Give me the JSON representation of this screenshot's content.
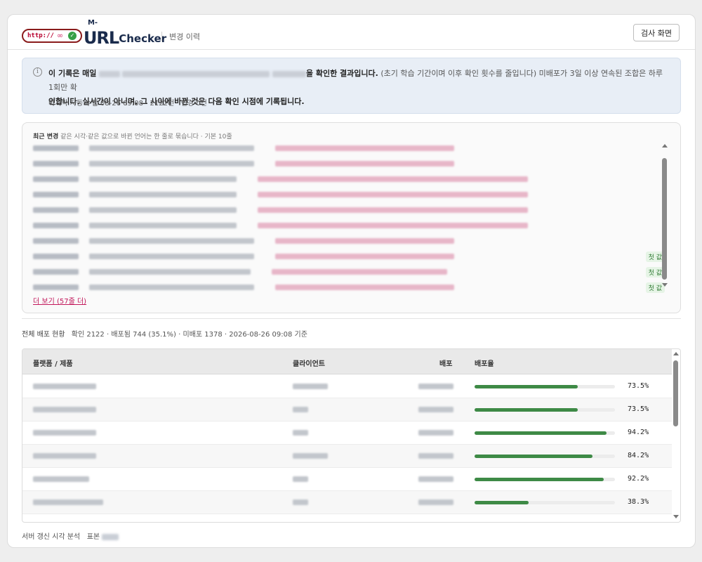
{
  "header": {
    "logo_http": "http://",
    "logo_m": "M-",
    "logo_url": "URL",
    "logo_checker": "Checker",
    "subtitle": "변경 이력",
    "inspect_button": "검사 화면"
  },
  "notice": {
    "line1_a": "이 기록은 매일",
    "line1_b": "을 확인한 결과입니다.",
    "line1_c": "(초기 학습 기간이며 이후 확인 횟수를 줄입니다)",
    "line1_d": "미배포가 3일 이상 연속된 조합은 하루 1회만 확",
    "line2": "인합니다. 실시간이 아니며, 그 사이에 바뀐 것은 다음 확인 시점에 기록됩니다.",
    "meta": "마지막 자동 수집 08-26 09:08 · 2122건 · 변경 0건"
  },
  "changes": {
    "title_bold": "최근 변경",
    "title_rest": "같은 시각·같은 값으로 바뀐 언어는 한 줄로 묶습니다 · 기본 10줄",
    "rows": [
      {
        "badge": ""
      },
      {
        "badge": ""
      },
      {
        "badge": ""
      },
      {
        "badge": ""
      },
      {
        "badge": ""
      },
      {
        "badge": ""
      },
      {
        "badge": ""
      },
      {
        "badge": "첫 값"
      },
      {
        "badge": "첫 값"
      },
      {
        "badge": "첫 값"
      }
    ],
    "more": "더 보기 (57줄 더)"
  },
  "summary": {
    "label": "전체 배포 현황",
    "text": "확인 2122 · 배포됨 744 (35.1%) · 미배포 1378 · 2026-08-26 09:08 기준"
  },
  "table": {
    "headers": {
      "platform": "플랫폼 / 제품",
      "client": "클라이언트",
      "deploy": "배포",
      "rate": "배포율"
    },
    "rows": [
      {
        "rate": 0.735,
        "pct": "73.5%"
      },
      {
        "rate": 0.735,
        "pct": "73.5%"
      },
      {
        "rate": 0.942,
        "pct": "94.2%"
      },
      {
        "rate": 0.842,
        "pct": "84.2%"
      },
      {
        "rate": 0.922,
        "pct": "92.2%"
      },
      {
        "rate": 0.383,
        "pct": "38.3%"
      }
    ]
  },
  "footer": {
    "label": "서버 갱신 시각 분석",
    "sample": "표본"
  }
}
